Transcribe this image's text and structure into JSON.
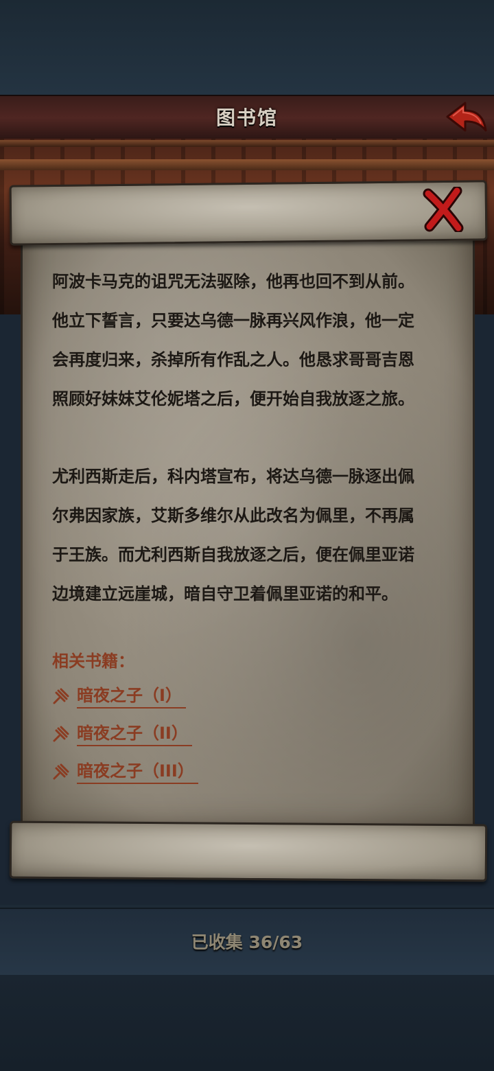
{
  "header": {
    "title": "图书馆"
  },
  "content": {
    "lines": [
      "阿波卡马克的诅咒无法驱除，他再也回不到从前。",
      "他立下誓言，只要达乌德一脉再兴风作浪，他一定",
      "会再度归来，杀掉所有作乱之人。他恳求哥哥吉恩",
      "照顾好妹妹艾伦妮塔之后，便开始自我放逐之旅。",
      "尤利西斯走后，科内塔宣布，将达乌德一脉逐出佩",
      "尔弗因家族，艾斯多维尔从此改名为佩里，不再属",
      "于王族。而尤利西斯自我放逐之后，便在佩里亚诺",
      "边境建立远崖城，暗自守卫着佩里亚诺的和平。"
    ],
    "related_title": "相关书籍：",
    "related_books": [
      "暗夜之子（I）",
      "暗夜之子（II）",
      "暗夜之子（III）"
    ]
  },
  "footer": {
    "collected": "已收集 36/63"
  },
  "icons": {
    "back": "back-arrow-icon",
    "close": "close-x-icon",
    "link": "quill-icon"
  },
  "colors": {
    "link": "#8a3c22",
    "text": "#1c1814",
    "close": "#c21b1b"
  }
}
